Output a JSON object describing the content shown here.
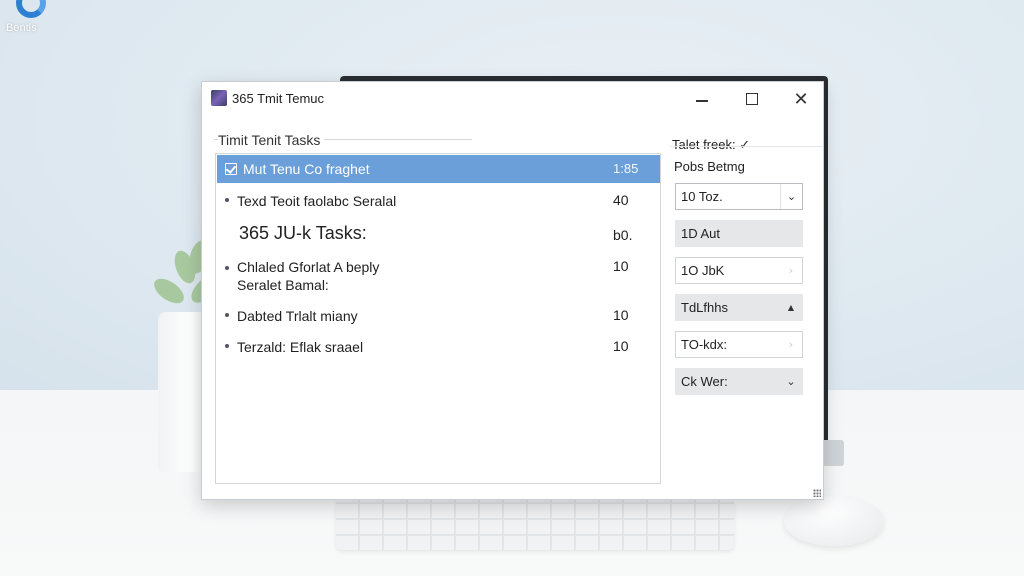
{
  "desktop": {
    "icon_label": "Bentls"
  },
  "window": {
    "title": "365 Tmit Temuc",
    "controls": {
      "minimize": "minimize",
      "maximize": "maximize",
      "close": "close"
    }
  },
  "tasks_group": {
    "title": "Timit Tenit Tasks",
    "rows": [
      {
        "label": "Mut Tenu Co fraghet",
        "value": "1:85",
        "selected": true
      },
      {
        "label": "Texd Teoit faolabc Seralal",
        "value": "40"
      },
      {
        "label": "365 JU-k Tasks:",
        "value": "b0."
      },
      {
        "label": "Chlaled Gforlat A beply",
        "label2": "Seralet Bamal:",
        "value": "10"
      },
      {
        "label": "Dabted Trlalt miany",
        "value": "10"
      },
      {
        "label": "Terzald: Eflak sraael",
        "value": "10"
      }
    ]
  },
  "right_panel": {
    "header": "Talet freek: ✓",
    "subheader": "Pobs Betmg",
    "fields": [
      {
        "value": "10 Toz.",
        "arrow": "chevron-down"
      },
      {
        "value": "1D Aut"
      },
      {
        "value": "1O JbK",
        "arrow": "chevron-right"
      },
      {
        "value": "TdLfhhs",
        "arrow": "caret-up"
      },
      {
        "value": "TO-kdx:",
        "arrow": "chevron-right"
      },
      {
        "value": "Ck Wer:",
        "arrow": "chevron-down"
      }
    ]
  },
  "glyphs": {
    "minimize": "—",
    "close": "✕",
    "chevron_down": "⌄",
    "chevron_right": "›",
    "caret_up": "▲"
  }
}
